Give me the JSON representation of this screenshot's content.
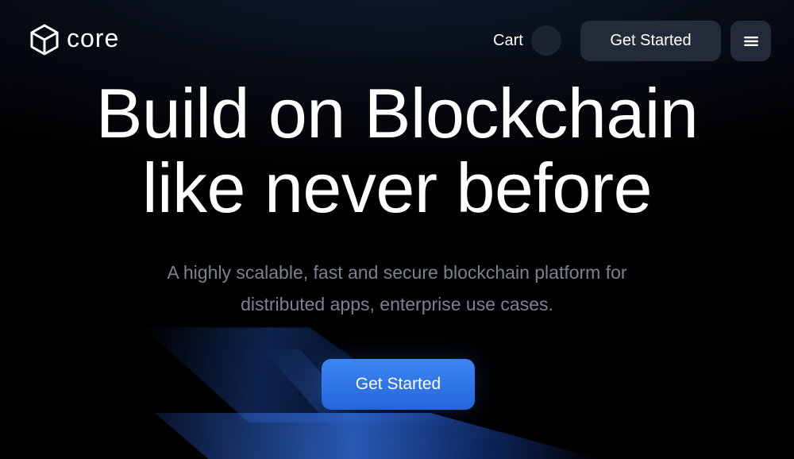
{
  "header": {
    "logo_text": "core",
    "logo_icon": "cube-icon",
    "cart_label": "Cart",
    "cart_count": "",
    "cta_label": "Get Started",
    "menu_icon": "hamburger-menu-icon"
  },
  "hero": {
    "title_line1": "Build on Blockchain",
    "title_line2": "like never before",
    "subtitle_line1": "A highly scalable, fast and secure blockchain platform for",
    "subtitle_line2": "distributed apps, enterprise use cases.",
    "cta_label": "Get Started"
  },
  "colors": {
    "background": "#000000",
    "nav_button_bg": "#222b37",
    "cart_badge_bg": "#1b2431",
    "primary_cta": "#2f74e6",
    "subtitle_text": "#7a8292",
    "text": "#ffffff"
  }
}
